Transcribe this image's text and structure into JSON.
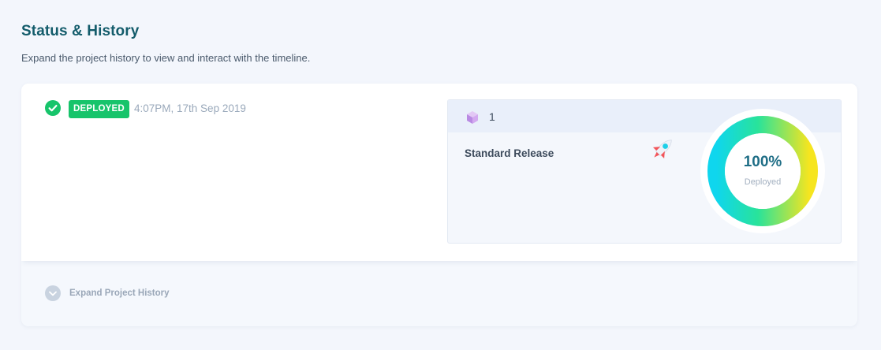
{
  "header": {
    "title": "Status & History",
    "subtitle": "Expand the project history to view and interact with the timeline."
  },
  "deployment": {
    "status": "DEPLOYED",
    "timestamp": "4:07PM, 17th Sep 2019",
    "status_color": "#17c46b"
  },
  "release": {
    "number": "1",
    "name": "Standard Release",
    "icon": "cube-icon",
    "illustration": "rocket-icon",
    "progress_percent": 100,
    "progress_text": "100%",
    "progress_label": "Deployed",
    "gradient_colors": [
      "#0fd6ee",
      "#29e39a",
      "#f6e51f"
    ]
  },
  "footer": {
    "expand_label": "Expand Project History",
    "expand_icon": "chevron-down-icon"
  }
}
